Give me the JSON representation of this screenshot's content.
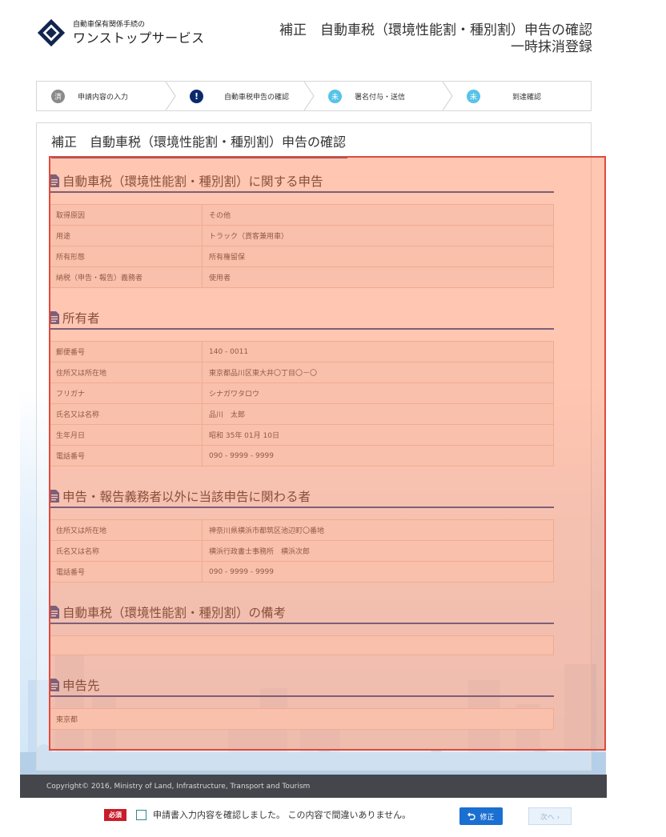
{
  "header": {
    "logo_sub": "自動車保有関係手続の",
    "logo_main": "ワンストップサービス",
    "title_line1": "補正　自動車税（環境性能割・種別割）申告の確認",
    "title_line2": "一時抹消登録"
  },
  "steps": [
    {
      "badge": "済",
      "label": "申請内容の入力",
      "state": "done"
    },
    {
      "badge": "!",
      "label": "自動車税申告の確認",
      "state": "current"
    },
    {
      "badge": "未",
      "label": "署名付与・送信",
      "state": "todo"
    },
    {
      "badge": "未",
      "label": "到達確認",
      "state": "todo"
    }
  ],
  "panel": {
    "title": "補正　自動車税（環境性能割・種別割）申告の確認"
  },
  "sections": {
    "tax": {
      "heading": "自動車税（環境性能割・種別割）に関する申告",
      "rows": [
        {
          "k": "取得原因",
          "v": "その他"
        },
        {
          "k": "用途",
          "v": "トラック（貨客兼用車）"
        },
        {
          "k": "所有形態",
          "v": "所有権留保"
        },
        {
          "k": "納税（申告・報告）義務者",
          "v": "使用者"
        }
      ]
    },
    "owner": {
      "heading": "所有者",
      "rows": [
        {
          "k": "郵便番号",
          "v": "140 - 0011"
        },
        {
          "k": "住所又は所在地",
          "v": "東京都品川区東大井〇丁目〇－〇"
        },
        {
          "k": "フリガナ",
          "v": "シナガワタロウ"
        },
        {
          "k": "氏名又は名称",
          "v": "品川　太郎"
        },
        {
          "k": "生年月日",
          "v": "昭和 35年 01月 10日"
        },
        {
          "k": "電話番号",
          "v": "090 - 9999 - 9999"
        }
      ]
    },
    "other": {
      "heading": "申告・報告義務者以外に当該申告に関わる者",
      "rows": [
        {
          "k": "住所又は所在地",
          "v": "神奈川県横浜市都筑区池辺町〇番地"
        },
        {
          "k": "氏名又は名称",
          "v": "横浜行政書士事務所　横浜次郎"
        },
        {
          "k": "電話番号",
          "v": "090 - 9999 - 9999"
        }
      ]
    },
    "remarks": {
      "heading": "自動車税（環境性能割・種別割）の備考"
    },
    "destination": {
      "heading": "申告先",
      "value": "東京都"
    }
  },
  "footer": {
    "copyright": "Copyright© 2016, Ministry of Land, Infrastructure, Transport and Tourism"
  },
  "confirm": {
    "required": "必須",
    "text": "申請書入力内容を確認しました。 この内容で間違いありません。",
    "fix_button": "修正",
    "next_button": "次へ ›"
  },
  "colors": {
    "accent": "#1f4e9e",
    "highlight": "#e04a3c",
    "required": "#c91d2b",
    "button": "#1b6fd1"
  }
}
